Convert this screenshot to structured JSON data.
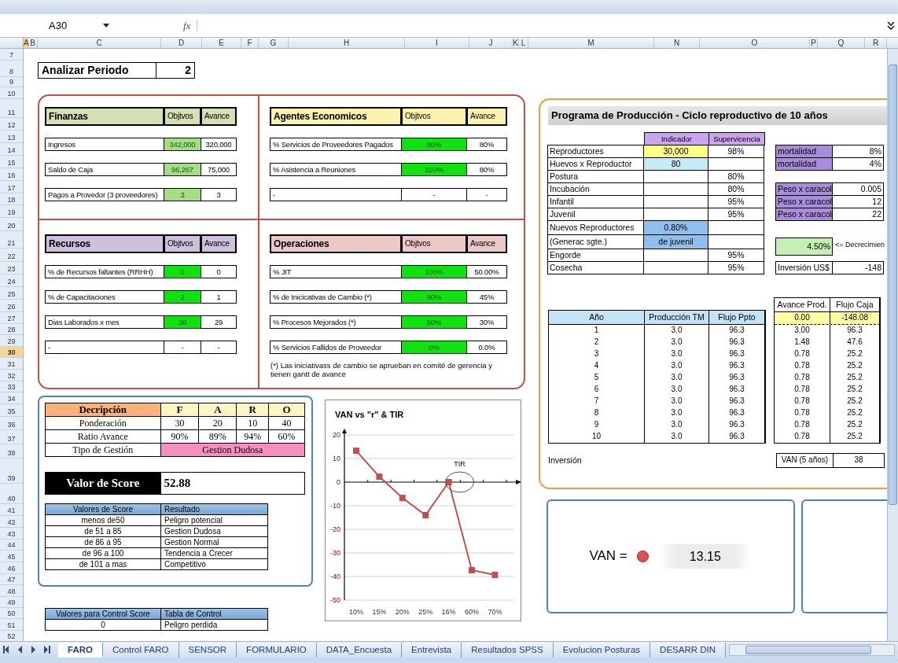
{
  "name_box": "A30",
  "formula_label": "fx",
  "columns": [
    {
      "label": "A",
      "selected": true
    },
    {
      "label": "B",
      "selected": false
    },
    {
      "label": "C",
      "selected": false
    },
    {
      "label": "D",
      "selected": false
    },
    {
      "label": "E",
      "selected": false
    },
    {
      "label": "F",
      "selected": false
    },
    {
      "label": "G",
      "selected": false
    },
    {
      "label": "H",
      "selected": false
    },
    {
      "label": "I",
      "selected": false
    },
    {
      "label": "J",
      "selected": false
    },
    {
      "label": "K",
      "selected": false
    },
    {
      "label": "L",
      "selected": false
    },
    {
      "label": "M",
      "selected": false
    },
    {
      "label": "N",
      "selected": false
    },
    {
      "label": "O",
      "selected": false
    },
    {
      "label": "P",
      "selected": false
    },
    {
      "label": "Q",
      "selected": false
    },
    {
      "label": "R",
      "selected": false
    }
  ],
  "rows": [
    {
      "label": "7",
      "selected": false
    },
    {
      "label": "8",
      "selected": false
    },
    {
      "label": "9",
      "selected": false
    },
    {
      "label": "10",
      "selected": false
    },
    {
      "label": "11",
      "selected": false
    },
    {
      "label": "12",
      "selected": false
    },
    {
      "label": "13",
      "selected": false
    },
    {
      "label": "14",
      "selected": false
    },
    {
      "label": "15",
      "selected": false
    },
    {
      "label": "16",
      "selected": false
    },
    {
      "label": "17",
      "selected": false
    },
    {
      "label": "18",
      "selected": false
    },
    {
      "label": "19",
      "selected": false
    },
    {
      "label": "20",
      "selected": false
    },
    {
      "label": "21",
      "selected": false
    },
    {
      "label": "22",
      "selected": false
    },
    {
      "label": "23",
      "selected": false
    },
    {
      "label": "24",
      "selected": false
    },
    {
      "label": "25",
      "selected": false
    },
    {
      "label": "26",
      "selected": false
    },
    {
      "label": "27",
      "selected": false
    },
    {
      "label": "28",
      "selected": false
    },
    {
      "label": "29",
      "selected": false
    },
    {
      "label": "30",
      "selected": true
    },
    {
      "label": "31",
      "selected": false
    },
    {
      "label": "32",
      "selected": false
    },
    {
      "label": "33",
      "selected": false
    },
    {
      "label": "34",
      "selected": false
    },
    {
      "label": "35",
      "selected": false
    },
    {
      "label": "36",
      "selected": false
    },
    {
      "label": "37",
      "selected": false
    },
    {
      "label": "38",
      "selected": false
    },
    {
      "label": "39",
      "selected": false
    },
    {
      "label": "40",
      "selected": false
    },
    {
      "label": "41",
      "selected": false
    },
    {
      "label": "42",
      "selected": false
    },
    {
      "label": "43",
      "selected": false
    },
    {
      "label": "44",
      "selected": false
    },
    {
      "label": "45",
      "selected": false
    },
    {
      "label": "46",
      "selected": false
    },
    {
      "label": "47",
      "selected": false
    },
    {
      "label": "48",
      "selected": false
    },
    {
      "label": "49",
      "selected": false
    },
    {
      "label": "50",
      "selected": false
    },
    {
      "label": "51",
      "selected": false
    },
    {
      "label": "52",
      "selected": false
    }
  ],
  "period": {
    "label": "Analizar Periodo",
    "value": "2"
  },
  "quadrants": [
    {
      "title": "Finanzas",
      "color": "#d3e0b4",
      "headers": [
        "Objtvos",
        "Avance"
      ],
      "rows": [
        {
          "label": "Ingresos",
          "target": "342,000",
          "color": "#a6dc86",
          "progress": "320,000"
        },
        {
          "label": "Saldo de Caja",
          "target": "96,267",
          "color": "#a6dc86",
          "progress": "75,000"
        },
        {
          "label": "Pagos a Provedor (3 proveedores)",
          "target": "3",
          "color": "#a6dc86",
          "progress": "3"
        }
      ]
    },
    {
      "title": "Agentes Economicos",
      "color": "#fdf3b0",
      "headers": [
        "Objtvos",
        "Avance"
      ],
      "rows": [
        {
          "label": "% Servicios de Proveedores Pagados",
          "target": "80%",
          "color": "#11e011",
          "progress": "80%"
        },
        {
          "label": "% Asistencia a Reuniones",
          "target": "100%",
          "color": "#11e011",
          "progress": "80%"
        },
        {
          "label": "-",
          "target": "-",
          "progress": "-"
        }
      ]
    },
    {
      "title": "Recursos",
      "color": "#cdc1dc",
      "headers": [
        "Objtvos",
        "Avance"
      ],
      "rows": [
        {
          "label": "% de Recursos faltantes (RRHH)",
          "target": "0",
          "color": "#11e011",
          "progress": "0"
        },
        {
          "label": "% de Capacitaciones",
          "target": "2",
          "color": "#11e011",
          "progress": "1"
        },
        {
          "label": "Dias Laborados x mes",
          "target": "30",
          "color": "#11e011",
          "progress": "29"
        },
        {
          "label": "-",
          "target": "-",
          "progress": "-"
        }
      ]
    },
    {
      "title": "Operaciones",
      "color": "#ecc9c8",
      "headers": [
        "Objtvos",
        "Avance"
      ],
      "rows": [
        {
          "label": "% JIT",
          "target": "100%",
          "color": "#11e011",
          "progress": "50.00%"
        },
        {
          "label": "% de Inicicativas de Cambio (*)",
          "target": "80%",
          "color": "#11e011",
          "progress": "45%"
        },
        {
          "label": "% Procesos Mejorados (*)",
          "target": "50%",
          "color": "#11e011",
          "progress": "30%"
        },
        {
          "label": "% Servicios Fallidos de Proveedor",
          "target": "0%",
          "color": "#11e011",
          "progress": "0.0%"
        }
      ],
      "note": "(*) Las iniciativass de cambio se aprueban en comité de gerencia  y tienen gantt de avance"
    }
  ],
  "score_table": {
    "header": [
      "Decripción",
      "F",
      "A",
      "R",
      "O"
    ],
    "rows": [
      [
        "Ponderación",
        "30",
        "20",
        "10",
        "40"
      ],
      [
        "Ratio Avance",
        "90%",
        "89%",
        "94%",
        "60%"
      ]
    ],
    "type_label": "Tipo de Gestión",
    "type_value": "Gestion Dudosa"
  },
  "score": {
    "label": "Valor de Score",
    "value": "52.88"
  },
  "score_ranges": {
    "columns": [
      "Valores de Score",
      "Resultado"
    ],
    "rows": [
      [
        "menos de50",
        "Peligro potencial"
      ],
      [
        "de 51 a 85",
        "Gestion Dudosa"
      ],
      [
        "de 86 a 95",
        "Gestion Normal"
      ],
      [
        "de 96 a 100",
        "Tendencia a Crecer"
      ],
      [
        "de 101 a mas",
        "Competitivo"
      ]
    ]
  },
  "control_table": {
    "columns": [
      "Valores para Control Score",
      "Tabla de Control"
    ],
    "rows": [
      [
        "0",
        "Peligro perdida"
      ]
    ]
  },
  "chart_data": {
    "type": "line",
    "title": "VAN vs \"r\" & TIR",
    "categories": [
      "10%",
      "15%",
      "20%",
      "25%",
      "16%",
      "60%",
      "70%"
    ],
    "series": [
      {
        "color": "#c0504d",
        "marker": "square",
        "values": [
          13.3,
          2.3,
          -6.7,
          -14,
          0,
          -37.3,
          -39.3
        ]
      }
    ],
    "ylim": [
      -50,
      20
    ],
    "yticks": [
      20,
      10,
      0,
      -10,
      -20,
      -30,
      -40,
      -50
    ],
    "grid": true,
    "annotations": [
      "TIR"
    ]
  },
  "production": {
    "title": "Programa de Producción - Ciclo reproductivo de 10 años",
    "param_columns": [
      "Indicador",
      "Supervicencia"
    ],
    "params": [
      {
        "label": "Reproductores",
        "indicator": "30,000",
        "color": "#ffff80",
        "survival": "98%"
      },
      {
        "label": "Huevos x Reproductor",
        "indicator": "80",
        "color": "#c5ecf6"
      },
      {
        "label": "Postura",
        "survival": "80%"
      },
      {
        "label": "Incubación",
        "survival": "80%"
      },
      {
        "label": "Infantil",
        "survival": "95%"
      },
      {
        "label": "Juvenil",
        "survival": "95%"
      },
      {
        "label": "Nuevos Reproductores",
        "indicator": "0.80%",
        "color": "#8fbfee",
        "kind": "double"
      },
      {
        "label": "(Generac sgte.)",
        "indicator": "de juvenil",
        "color": "#8fbfee",
        "kind": "double"
      },
      {
        "label": "Engorde",
        "survival": "95%"
      },
      {
        "label": "Cosecha",
        "survival": "95%"
      }
    ],
    "side_boxes": [
      {
        "kind": "mortality",
        "label": "mortalidad",
        "value": "8%"
      },
      {
        "kind": "mortality",
        "label": "mortalidad",
        "value": "4%"
      },
      {
        "kind": "weight",
        "label": "Peso x caracol",
        "value": "0.005"
      },
      {
        "kind": "weight",
        "label": "Peso x caracol",
        "value": "12"
      },
      {
        "kind": "weight",
        "label": "Peso x caracol",
        "value": "22"
      },
      {
        "kind": "growth",
        "value": "4.50%",
        "note": "<= Decrecimien"
      },
      {
        "kind": "investment",
        "label": "Inversión US$",
        "value": "-148"
      }
    ],
    "years": {
      "columns": [
        "Año",
        "Producción TM",
        "Flujo Ppto"
      ],
      "rows": [
        [
          "1",
          "3.0",
          "96.3"
        ],
        [
          "2",
          "3.0",
          "96.3"
        ],
        [
          "3",
          "3.0",
          "96.3"
        ],
        [
          "4",
          "3.0",
          "96.3"
        ],
        [
          "5",
          "3.0",
          "96.3"
        ],
        [
          "6",
          "3.0",
          "96.3"
        ],
        [
          "7",
          "3.0",
          "96.3"
        ],
        [
          "8",
          "3.0",
          "96.3"
        ],
        [
          "9",
          "3.0",
          "96.3"
        ],
        [
          "10",
          "3.0",
          "96.3"
        ]
      ]
    },
    "cash": {
      "columns": [
        "Avance Prod.",
        "Flujo Caja"
      ],
      "rows": [
        {
          "cells": [
            "0.00",
            "-148.08"
          ],
          "highlighted": true
        },
        {
          "cells": [
            "3.00",
            "96.3"
          ],
          "highlighted": false
        },
        {
          "cells": [
            "1.48",
            "47.6"
          ],
          "highlighted": false
        },
        {
          "cells": [
            "0.78",
            "25.2"
          ],
          "highlighted": false
        },
        {
          "cells": [
            "0.78",
            "25.2"
          ],
          "highlighted": false
        },
        {
          "cells": [
            "0.78",
            "25.2"
          ],
          "highlighted": false
        },
        {
          "cells": [
            "0.78",
            "25.2"
          ],
          "highlighted": false
        },
        {
          "cells": [
            "0.78",
            "25.2"
          ],
          "highlighted": false
        },
        {
          "cells": [
            "0.78",
            "25.2"
          ],
          "highlighted": false
        },
        {
          "cells": [
            "0.78",
            "25.2"
          ],
          "highlighted": false
        },
        {
          "cells": [
            "0.78",
            "25.2"
          ],
          "highlighted": false
        }
      ]
    },
    "investment_label": "Inversión",
    "van_box": {
      "label": "VAN (5 años)",
      "value": "38"
    }
  },
  "van": {
    "label": "VAN =",
    "color": "#e05050",
    "value": "13.15"
  },
  "sheet_tabs": [
    {
      "label": "FARO",
      "selected": true
    },
    {
      "label": "Control FARO",
      "selected": false
    },
    {
      "label": "SENSOR",
      "selected": false
    },
    {
      "label": "FORMULARIO",
      "selected": false
    },
    {
      "label": "DATA_Encuesta",
      "selected": false
    },
    {
      "label": "Entrevista",
      "selected": false
    },
    {
      "label": "Resultados SPSS",
      "selected": false
    },
    {
      "label": "Evolucion Posturas",
      "selected": false
    },
    {
      "label": "DESARR DIN",
      "selected": false
    }
  ]
}
